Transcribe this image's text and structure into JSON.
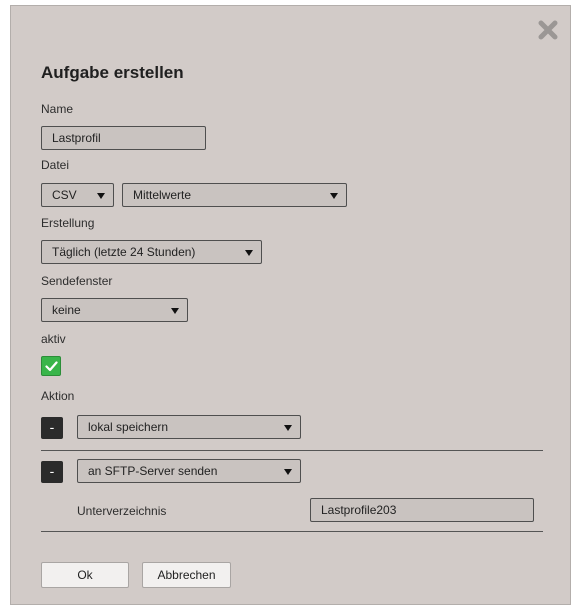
{
  "dialog": {
    "title": "Aufgabe erstellen",
    "close_icon": "close-x-icon"
  },
  "form": {
    "name_label": "Name",
    "name_value": "Lastprofil",
    "datei_label": "Datei",
    "datei_format": "CSV",
    "datei_type": "Mittelwerte",
    "erstellung_label": "Erstellung",
    "erstellung_value": "Täglich (letzte 24 Stunden)",
    "sendefenster_label": "Sendefenster",
    "sendefenster_value": "keine",
    "aktiv_label": "aktiv",
    "aktiv_checked": true,
    "aktion_label": "Aktion"
  },
  "actions": [
    {
      "remove_label": "-",
      "value": "lokal speichern"
    },
    {
      "remove_label": "-",
      "value": "an SFTP-Server senden",
      "sub_label": "Unterverzeichnis",
      "sub_value": "Lastprofile203"
    }
  ],
  "buttons": {
    "ok": "Ok",
    "cancel": "Abbrechen"
  },
  "colors": {
    "dialog_bg": "#d2cbc8",
    "checkbox": "#39b54a",
    "remove_button": "#2b2b2b"
  }
}
